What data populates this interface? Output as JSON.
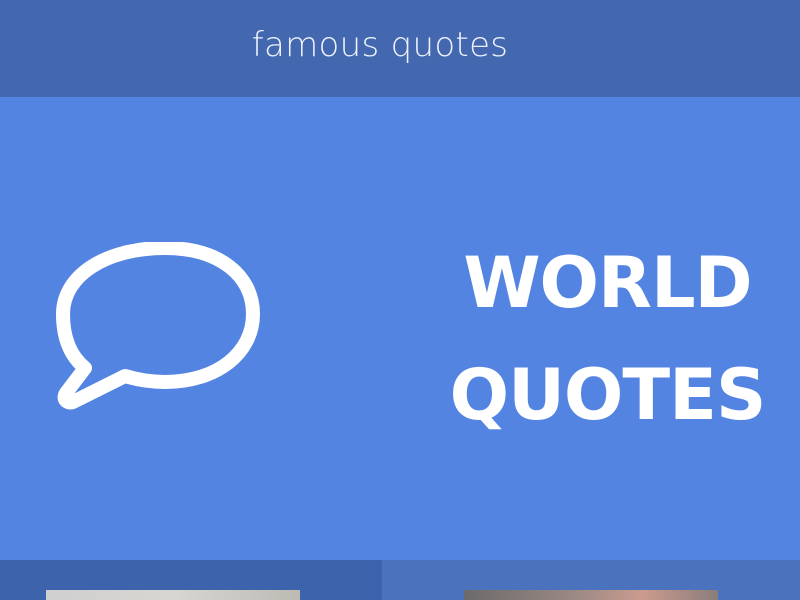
{
  "header": {
    "title": "famous quotes"
  },
  "hero": {
    "icon": "speech-bubble-icon",
    "headline_line1": "WORLD",
    "headline_line2": "QUOTES"
  },
  "quote_cards": [
    {
      "thumbnail": "quote-thumbnail-1"
    },
    {
      "thumbnail": "quote-thumbnail-2"
    }
  ],
  "colors": {
    "header_bg": "#4468b0",
    "hero_bg": "#5484e2",
    "text": "#ffffff"
  }
}
